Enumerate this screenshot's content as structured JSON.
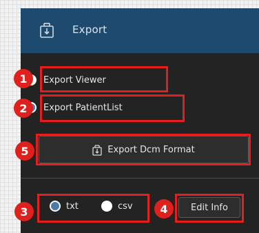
{
  "header": {
    "title": "Export",
    "icon": "export-icon"
  },
  "options": {
    "export_viewer": {
      "label": "Export Viewer",
      "selected": false
    },
    "export_patient_list": {
      "label": "Export PatientList",
      "selected": true
    }
  },
  "export_dcm_button": {
    "label": "Export Dcm Format",
    "icon": "export-icon"
  },
  "format": {
    "txt": {
      "label": "txt",
      "selected": true
    },
    "csv": {
      "label": "csv",
      "selected": false
    }
  },
  "edit_info_button": {
    "label": "Edit Info"
  },
  "callouts": {
    "1": "1",
    "2": "2",
    "3": "3",
    "4": "4",
    "5": "5"
  },
  "colors": {
    "header_bg": "#1e4a6e",
    "panel_bg": "#232323",
    "callout_red": "#e61e1e",
    "radio_selected": "#4c7ba8"
  }
}
